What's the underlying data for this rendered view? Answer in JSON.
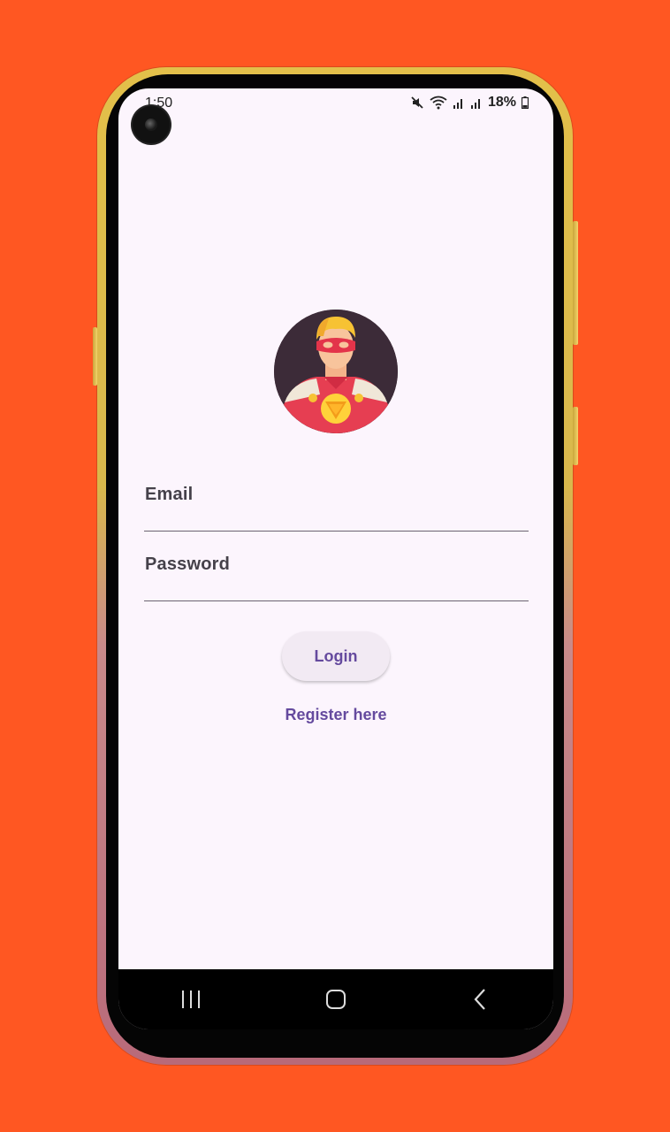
{
  "status_bar": {
    "time": "1:50",
    "battery": "18%",
    "icons": [
      "mute-icon",
      "wifi-icon",
      "signal-icon",
      "signal-icon",
      "battery-icon"
    ]
  },
  "login": {
    "avatar_icon": "superhero-avatar",
    "email_label": "Email",
    "password_label": "Password",
    "login_button": "Login",
    "register_link": "Register here"
  },
  "nav_bar": {
    "items": [
      "recent-apps-icon",
      "home-icon",
      "back-icon"
    ]
  },
  "colors": {
    "background": "#ff5722",
    "screen": "#fcf5fd",
    "accent": "#654a9e"
  }
}
